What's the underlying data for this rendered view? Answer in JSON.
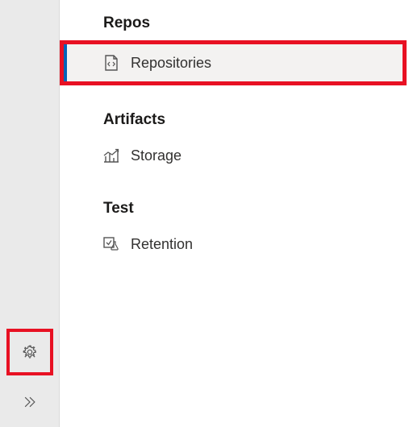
{
  "nav": {
    "sections": [
      {
        "header": "Repos",
        "items": [
          {
            "label": "Repositories",
            "icon": "code-file-icon",
            "selected": true,
            "highlighted": true
          }
        ]
      },
      {
        "header": "Artifacts",
        "items": [
          {
            "label": "Storage",
            "icon": "chart-icon",
            "selected": false,
            "highlighted": false
          }
        ]
      },
      {
        "header": "Test",
        "items": [
          {
            "label": "Retention",
            "icon": "flask-check-icon",
            "selected": false,
            "highlighted": false
          }
        ]
      }
    ]
  },
  "rail": {
    "settings_highlighted": true
  }
}
